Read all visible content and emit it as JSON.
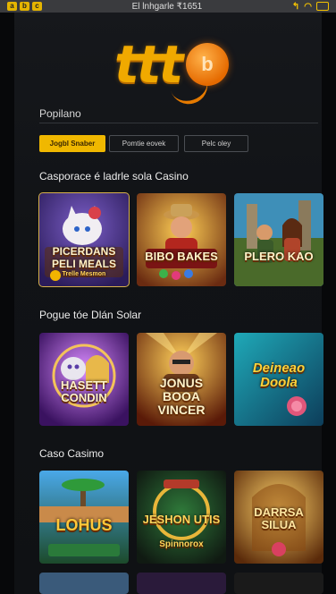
{
  "status_bar": {
    "left_icons": [
      "a",
      "b",
      "c"
    ],
    "center_text": "El lnhgarle ₹1651",
    "right_icons": [
      "arrow",
      "wifi",
      "battery"
    ]
  },
  "logo": {
    "text": "ttt",
    "badge": "b"
  },
  "popular_label": "Popilano",
  "tabs": [
    {
      "label": "Jogbl Snaber",
      "active": true
    },
    {
      "label": "Pomtie eovek",
      "active": false
    },
    {
      "label": "Pelc oley",
      "active": false
    }
  ],
  "sections": [
    {
      "heading": "Casporace é ladrle sola Casino",
      "games": [
        {
          "title": "PICERDANS PELI MEALS",
          "subtitle": "Trelle Mesmon",
          "theme": "cat"
        },
        {
          "title": "BIBO BAKES",
          "subtitle": "",
          "theme": "adventurer"
        },
        {
          "title": "PLERO KAO",
          "subtitle": "",
          "theme": "jungle"
        }
      ]
    },
    {
      "heading": "Pogue tóe Dlán Solar",
      "games": [
        {
          "title": "HASETT CONDIN",
          "subtitle": "",
          "theme": "cat-purple"
        },
        {
          "title": "JONUS BOOA VINCER",
          "subtitle": "",
          "theme": "man-rays"
        },
        {
          "title": "Deineao Doola",
          "subtitle": "",
          "theme": "teal"
        }
      ]
    },
    {
      "heading": "Caso Casimo",
      "games": [
        {
          "title": "LOHUS",
          "subtitle": "",
          "theme": "palms"
        },
        {
          "title": "JESHON UTIS",
          "subtitle": "Spinnorox",
          "theme": "dark-gold"
        },
        {
          "title": "DARRSA SILUA",
          "subtitle": "",
          "theme": "golden"
        }
      ]
    }
  ],
  "colors": {
    "accent": "#f0b800",
    "background": "#111316",
    "tab_border": "#4b4e53"
  }
}
